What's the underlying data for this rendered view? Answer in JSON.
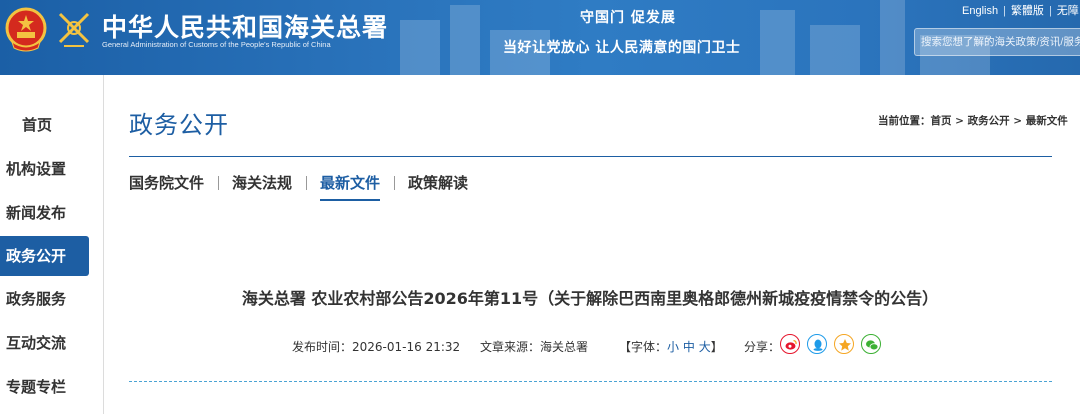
{
  "header": {
    "site_title": "中华人民共和国海关总署",
    "site_subtitle": "General Administration of Customs of the People's Republic of China",
    "slogan_line1": "守国门  促发展",
    "slogan_line2": "当好让党放心  让人民满意的国门卫士",
    "lang_english": "English",
    "lang_traditional": "繁體版",
    "lang_accessible": "无障",
    "search_placeholder": "搜索您想了解的海关政策/资讯/服务"
  },
  "sidenav": {
    "items": [
      {
        "label": "首页"
      },
      {
        "label": "机构设置"
      },
      {
        "label": "新闻发布"
      },
      {
        "label": "政务公开"
      },
      {
        "label": "政务服务"
      },
      {
        "label": "互动交流"
      },
      {
        "label": "专题专栏"
      }
    ],
    "active_index": 3
  },
  "main": {
    "heading": "政务公开",
    "breadcrumb": {
      "prefix": "当前位置：",
      "items": [
        "首页",
        "政务公开",
        "最新文件"
      ],
      "separator": " > "
    },
    "tabs": [
      {
        "label": "国务院文件"
      },
      {
        "label": "海关法规"
      },
      {
        "label": "最新文件"
      },
      {
        "label": "政策解读"
      }
    ],
    "active_tab": 2
  },
  "article": {
    "title": "海关总署 农业农村部公告2026年第11号（关于解除巴西南里奥格郎德州新城疫疫情禁令的公告）",
    "publish_label": "发布时间：",
    "publish_time": "2026-01-16 21:32",
    "source_label": "文章来源：",
    "source": "海关总署",
    "font_label": "【字体：",
    "font_small": "小",
    "font_medium": "中",
    "font_large": "大",
    "font_close": "】",
    "share_label": "分享："
  },
  "share_icons": [
    {
      "name": "weibo-icon",
      "color": "#e6162d"
    },
    {
      "name": "qq-icon",
      "color": "#1e9be9"
    },
    {
      "name": "qzone-icon",
      "color": "#f5a623"
    },
    {
      "name": "wechat-icon",
      "color": "#3cb034"
    }
  ],
  "colors": {
    "brand_blue": "#1d5ea3",
    "header_blue": "#2a73bb",
    "dash_rule": "#4aa3d4"
  }
}
